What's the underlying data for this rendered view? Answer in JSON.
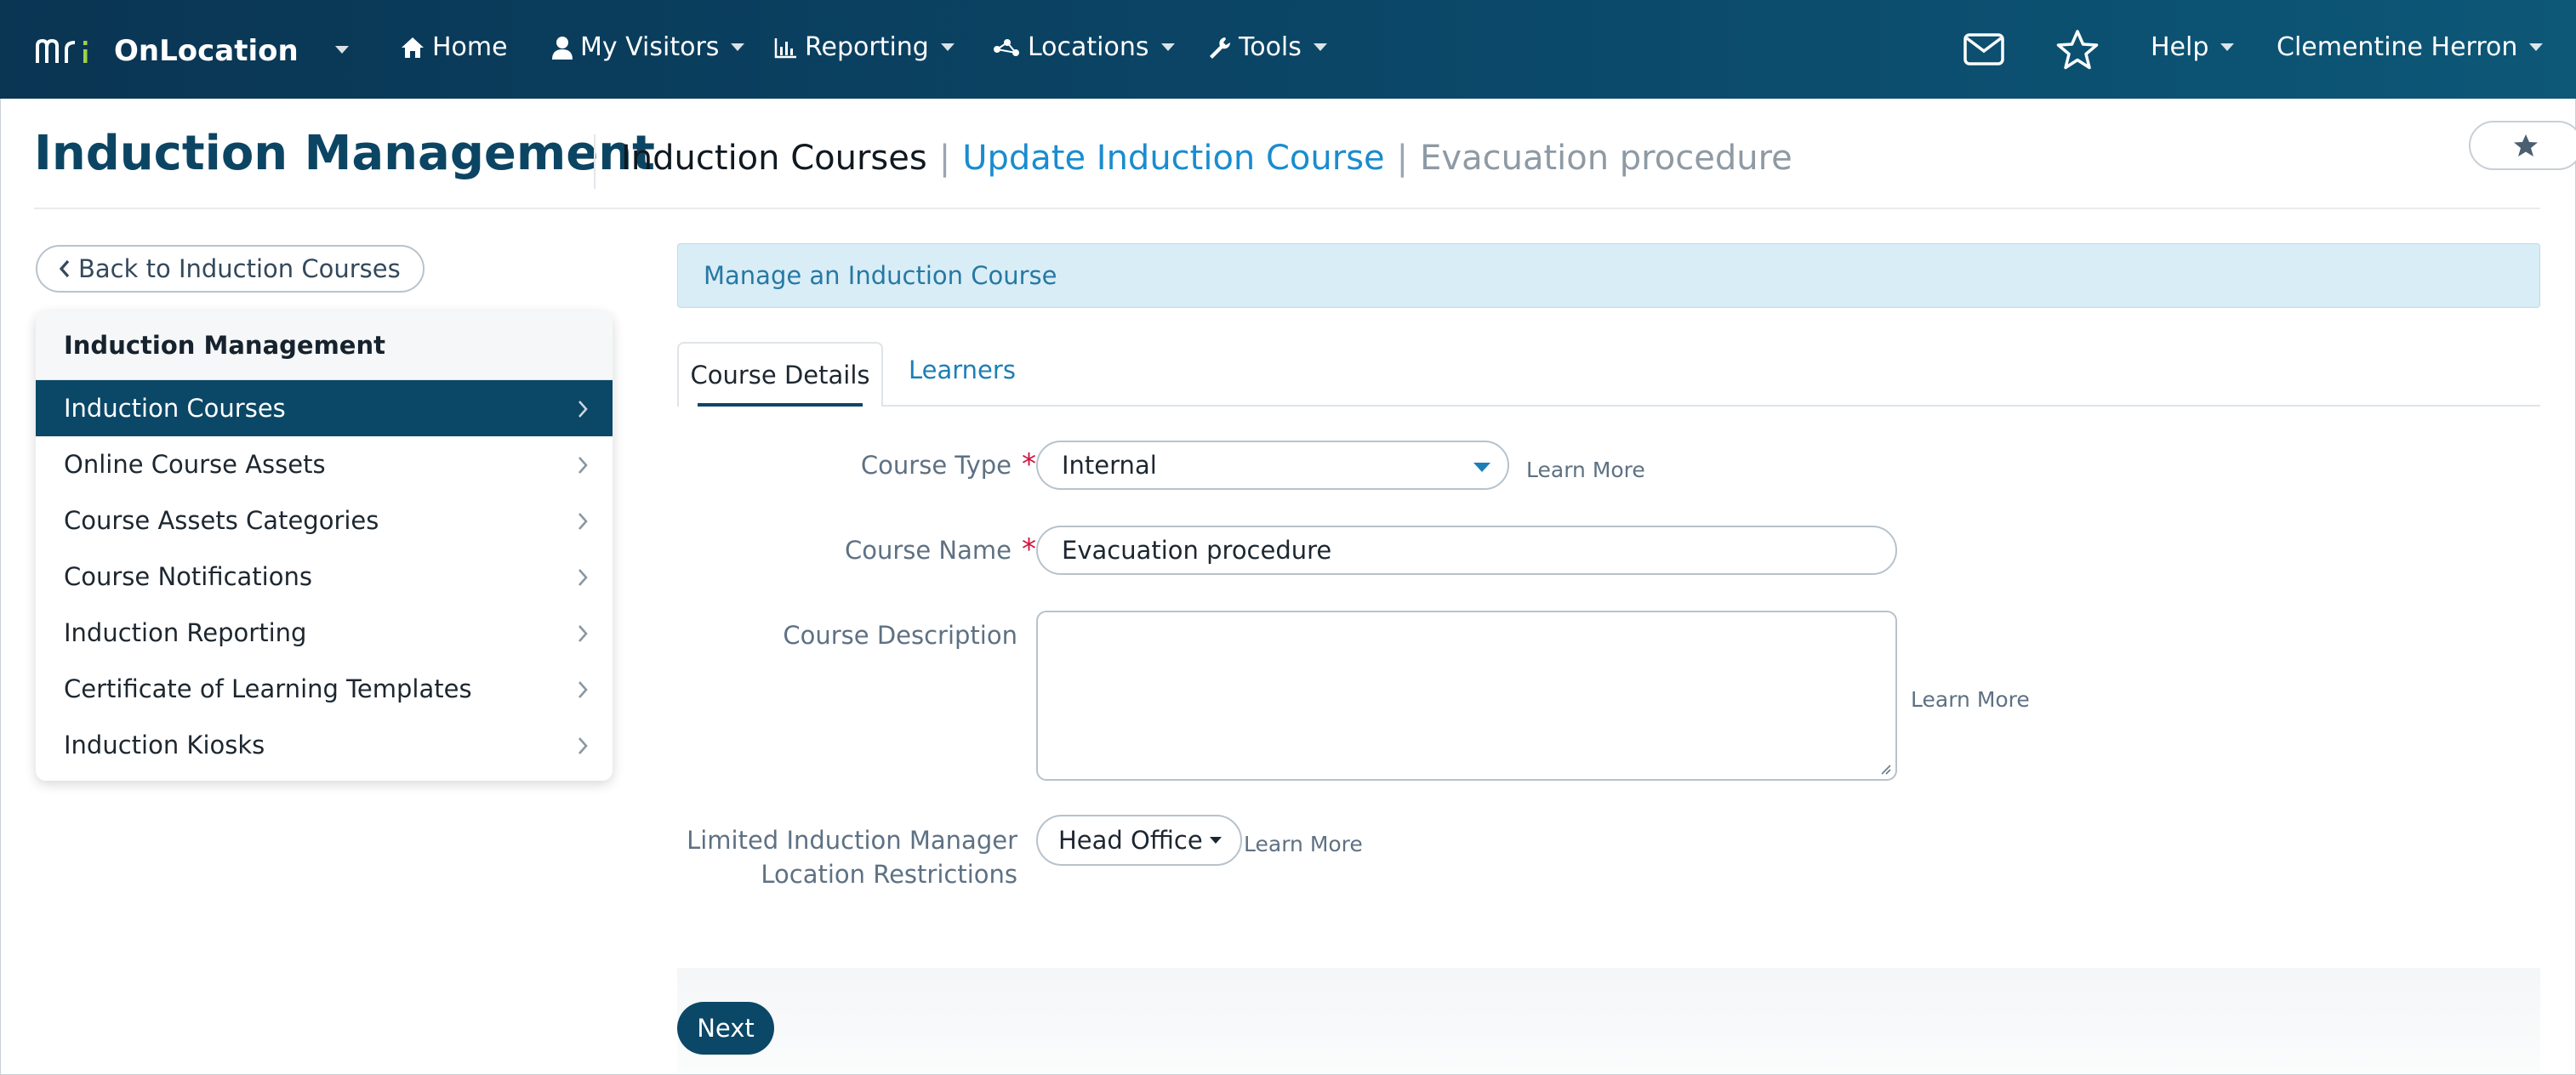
{
  "colors": {
    "brand_dark": "#0b4766",
    "accent_link": "#1a8ccf",
    "required": "#d0143f",
    "info_bg": "#d9edf7"
  },
  "topnav": {
    "brand_logo": "mri",
    "brand_name": "OnLocation",
    "items": [
      {
        "label": "Home",
        "icon": "home-icon"
      },
      {
        "label": "My Visitors",
        "icon": "user-icon"
      },
      {
        "label": "Reporting",
        "icon": "bar-chart-icon"
      },
      {
        "label": "Locations",
        "icon": "network-icon"
      },
      {
        "label": "Tools",
        "icon": "wrench-icon"
      }
    ],
    "help_label": "Help",
    "user_name": "Clementine Herron",
    "mail_icon": "mail-icon",
    "star_icon": "star-icon"
  },
  "header": {
    "title": "Induction Management",
    "breadcrumb": [
      "Induction Courses",
      "Update Induction Course",
      "Evacuation procedure"
    ]
  },
  "sidebar": {
    "back_label": "Back to Induction Courses",
    "heading": "Induction Management",
    "items": [
      {
        "label": "Induction Courses",
        "active": true
      },
      {
        "label": "Online Course Assets"
      },
      {
        "label": "Course Assets Categories"
      },
      {
        "label": "Course Notifications"
      },
      {
        "label": "Induction Reporting"
      },
      {
        "label": "Certificate of Learning Templates"
      },
      {
        "label": "Induction Kiosks"
      }
    ]
  },
  "main": {
    "info": "Manage an Induction Course",
    "tabs": [
      {
        "label": "Course Details",
        "active": true
      },
      {
        "label": "Learners"
      }
    ],
    "form": {
      "course_type": {
        "label": "Course Type",
        "value": "Internal",
        "learn_more": "Learn More"
      },
      "course_name": {
        "label": "Course Name",
        "value": "Evacuation procedure"
      },
      "course_description": {
        "label": "Course Description",
        "value": "",
        "learn_more": "Learn More"
      },
      "location_restrictions": {
        "label_line1": "Limited Induction Manager",
        "label_line2": "Location Restrictions",
        "value": "Head Office",
        "learn_more": "Learn More"
      },
      "required_mark": "*"
    },
    "next_label": "Next"
  }
}
